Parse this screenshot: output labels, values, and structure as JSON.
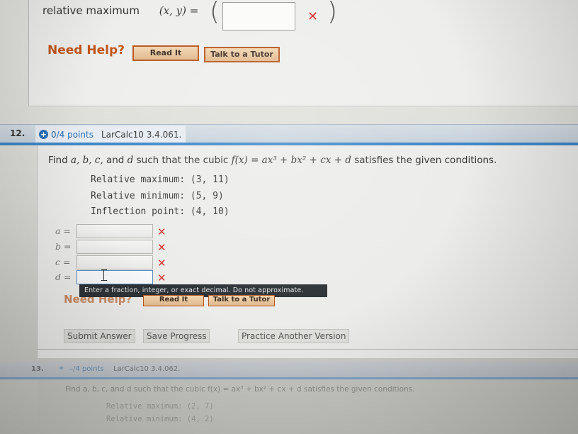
{
  "prev_question": {
    "relmax_label": "relative maximum",
    "xy_label": "(x, y) =",
    "open_paren": "(",
    "close_paren": ")",
    "input_value": "",
    "wrong_mark": "✕",
    "need_help": "Need Help?",
    "read_it": "Read It",
    "talk_to_tutor": "Talk to a Tutor"
  },
  "question12": {
    "number": "12.",
    "points": "0/4 points",
    "reference": "LarCalc10 3.4.061.",
    "prompt_pre": "Find ",
    "prompt_vars": "a, b, c,",
    "prompt_and": " and ",
    "prompt_d": "d",
    "prompt_mid": " such that the cubic ",
    "prompt_fx": "f(x) = ax³ + bx² + cx + d",
    "prompt_post": " satisfies the given conditions.",
    "conditions": [
      "Relative maximum: (3, 11)",
      "Relative minimum: (5, 9)",
      "Inflection point: (4, 10)"
    ],
    "variables": [
      {
        "label": "a =",
        "value": "",
        "mark": "✕"
      },
      {
        "label": "b =",
        "value": "",
        "mark": "✕"
      },
      {
        "label": "c =",
        "value": "",
        "mark": "✕"
      },
      {
        "label": "d =",
        "value": "",
        "mark": "✕"
      }
    ],
    "tooltip": "Enter a fraction, integer, or exact decimal. Do not approximate.",
    "need_help": "Need Help?",
    "read_it": "Read It",
    "talk_to_tutor": "Talk to a Tutor",
    "submit_answer": "Submit Answer",
    "save_progress": "Save Progress",
    "practice_another": "Practice Another Version"
  },
  "question13": {
    "number": "13.",
    "points": "–/4 points",
    "reference": "LarCalc10 3.4.062.",
    "prompt": "Find a, b, c, and d such that the cubic f(x) = ax³ + bx² + cx + d satisfies the given conditions.",
    "conditions": [
      "Relative maximum: (2, 7)",
      "Relative minimum: (4, 2)"
    ]
  },
  "colors": {
    "accent_blue": "#3f87c8",
    "points_blue": "#2d6fb5",
    "wrong_red": "#d0342c",
    "help_orange": "#c0551c",
    "tooltip_bg": "#2d3236"
  }
}
